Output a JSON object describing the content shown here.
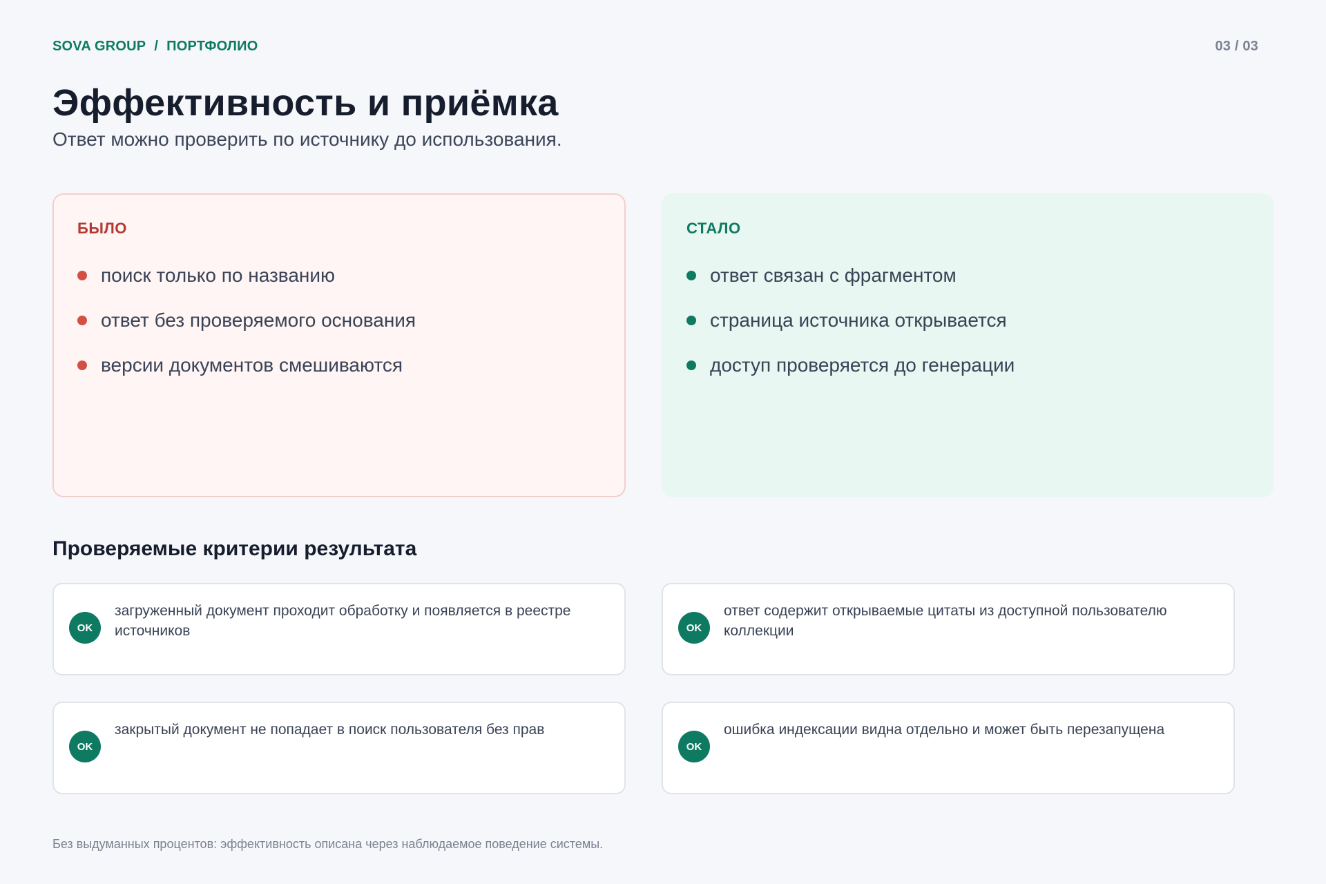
{
  "header": {
    "brand": "SOVA GROUP",
    "separator": "/",
    "section": "ПОРТФОЛИО",
    "page_counter": "03 / 03"
  },
  "title": "Эффективность и приёмка",
  "subtitle": "Ответ можно проверить по источнику до использования.",
  "before": {
    "label": "БЫЛО",
    "items": [
      "поиск только по названию",
      "ответ без проверяемого основания",
      "версии документов смешиваются"
    ]
  },
  "after": {
    "label": "СТАЛО",
    "items": [
      "ответ связан с фрагментом",
      "страница источника открывается",
      "доступ проверяется до генерации"
    ]
  },
  "criteria": {
    "title": "Проверяемые критерии результата",
    "badge": "OK",
    "items": [
      "загруженный документ проходит обработку и появляется в реестре источников",
      "ответ содержит открываемые цитаты из доступной пользователю коллекции",
      "закрытый документ не попадает в поиск пользователя без прав",
      "ошибка индексации видна отдельно и может быть перезапущена"
    ]
  },
  "footnote": "Без выдуманных процентов: эффективность описана через наблюдаемое поведение системы.",
  "colors": {
    "accent_green": "#0d7a61",
    "accent_red": "#d44e44",
    "before_bg": "#fff5f4",
    "after_bg": "#e8f7f1"
  }
}
